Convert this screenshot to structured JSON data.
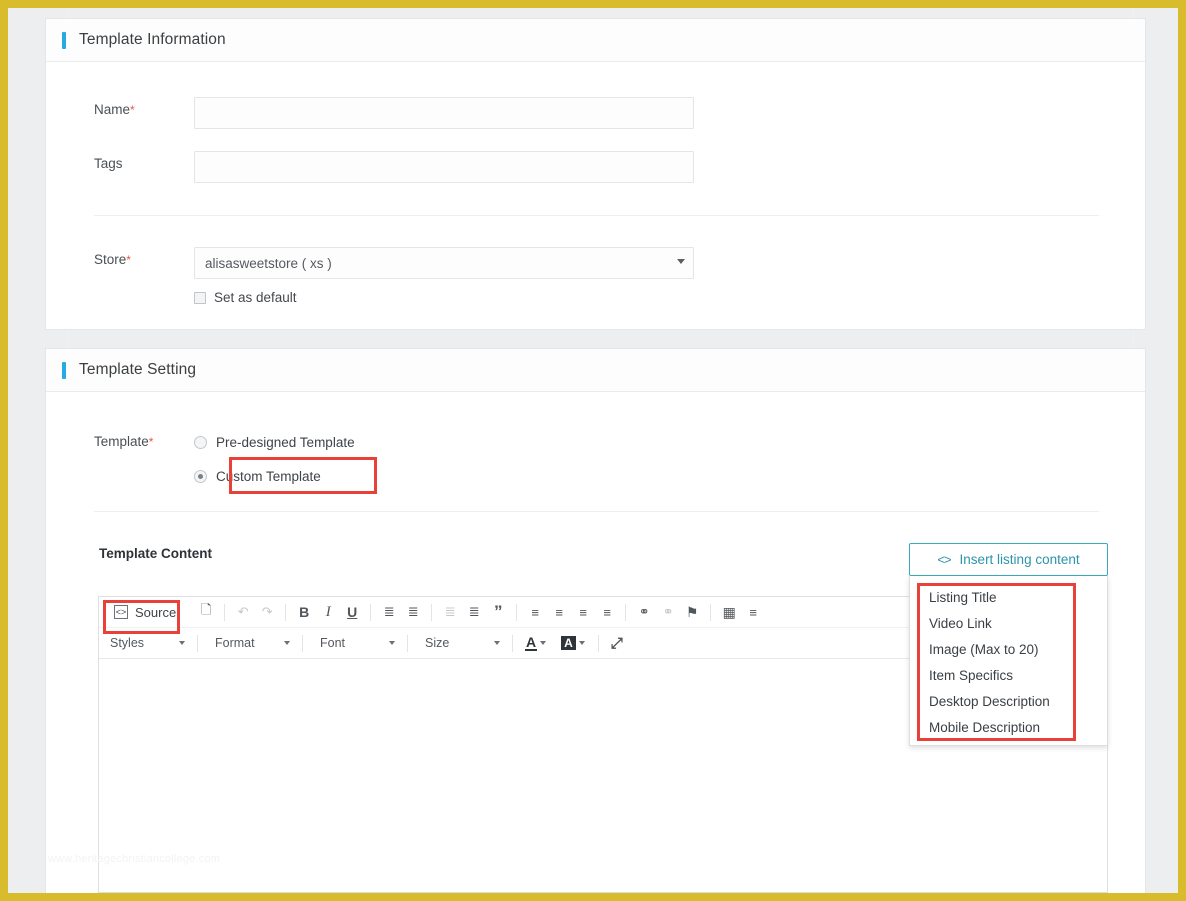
{
  "theme": {
    "outer_border": "#d9bc2c",
    "page_background": "#eceef0",
    "accent": "#27a9e1",
    "annotation": "#e8413a",
    "insert_button_border": "#3ba9bf",
    "required_marker": "#e8564d"
  },
  "template_information": {
    "title": "Template Information",
    "name": {
      "label": "Name",
      "required": "*",
      "value": "",
      "placeholder": ""
    },
    "tags": {
      "label": "Tags",
      "value": "",
      "placeholder": ""
    },
    "store": {
      "label": "Store",
      "required": "*",
      "selected": "alisasweetstore ( xs )",
      "caret": "chevron-down-icon"
    },
    "set_as_default": {
      "label": "Set as default",
      "checked": false
    }
  },
  "template_setting": {
    "title": "Template Setting",
    "template_field": {
      "label": "Template",
      "required": "*",
      "options": [
        {
          "label": "Pre-designed Template",
          "selected": false
        },
        {
          "label": "Custom Template",
          "selected": true
        }
      ]
    },
    "template_content": {
      "label": "Template Content",
      "insert_button": {
        "label": "Insert listing content",
        "icon": "code-brackets-icon"
      },
      "dropdown_items": [
        "Listing Title",
        "Video Link",
        "Image (Max to 20)",
        "Item Specifics",
        "Desktop Description",
        "Mobile Description"
      ]
    },
    "editor": {
      "source_button": "Source",
      "toolbar_row1": [
        {
          "name": "new-page-icon",
          "glyph": "⎕",
          "dim": false
        },
        {
          "name": "undo-icon",
          "glyph": "↶",
          "dim": true
        },
        {
          "name": "redo-icon",
          "glyph": "↷",
          "dim": true
        },
        {
          "name": "bold-icon",
          "glyph": "B",
          "dim": false
        },
        {
          "name": "italic-icon",
          "glyph": "I",
          "dim": false
        },
        {
          "name": "underline-icon",
          "glyph": "U",
          "dim": false
        },
        {
          "name": "numbered-list-icon",
          "glyph": "≣",
          "dim": false
        },
        {
          "name": "bulleted-list-icon",
          "glyph": "≣",
          "dim": false
        },
        {
          "name": "decrease-indent-icon",
          "glyph": "≣",
          "dim": true
        },
        {
          "name": "increase-indent-icon",
          "glyph": "≣",
          "dim": false
        },
        {
          "name": "blockquote-icon",
          "glyph": "”",
          "dim": false
        },
        {
          "name": "align-left-icon",
          "glyph": "≡",
          "dim": false
        },
        {
          "name": "align-center-icon",
          "glyph": "≡",
          "dim": false
        },
        {
          "name": "align-right-icon",
          "glyph": "≡",
          "dim": false
        },
        {
          "name": "justify-icon",
          "glyph": "≡",
          "dim": false
        },
        {
          "name": "link-icon",
          "glyph": "⚭",
          "dim": false
        },
        {
          "name": "unlink-icon",
          "glyph": "⚭",
          "dim": true
        },
        {
          "name": "anchor-flag-icon",
          "glyph": "⚑",
          "dim": false
        },
        {
          "name": "table-icon",
          "glyph": "▦",
          "dim": false
        },
        {
          "name": "horizontal-rule-icon",
          "glyph": "≡",
          "dim": false
        }
      ],
      "toolbar_row2": {
        "styles": "Styles",
        "format": "Format",
        "font": "Font",
        "size": "Size",
        "text_color": "A",
        "background_color": "A",
        "maximize": "⤢"
      },
      "content": ""
    }
  },
  "watermark": "www.heritagechristiancollege.com"
}
